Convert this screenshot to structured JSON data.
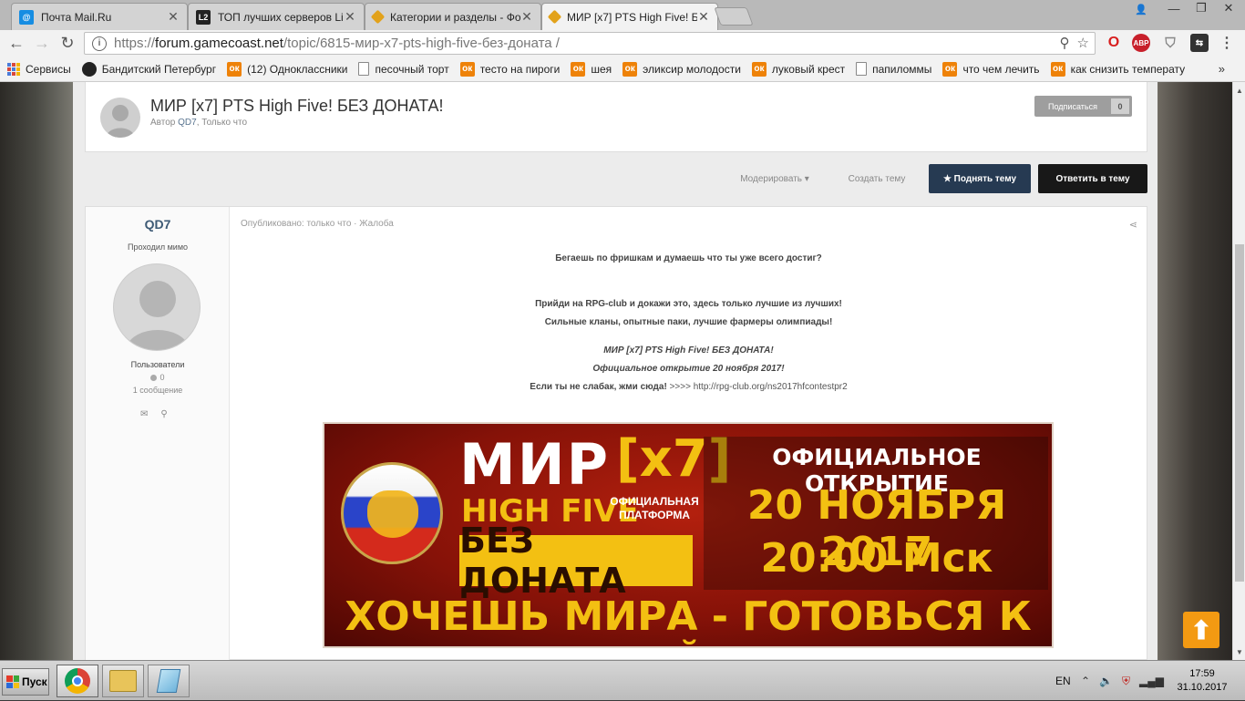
{
  "browser": {
    "tabs": [
      {
        "title": "Почта Mail.Ru",
        "icon": "mailru-icon",
        "active": false
      },
      {
        "title": "ТОП лучших серверов Lin",
        "icon": "l2-icon",
        "active": false
      },
      {
        "title": "Категории и разделы - Фо",
        "icon": "gamecoast-icon",
        "active": false
      },
      {
        "title": "МИР [x7] PTS High Five! Б",
        "icon": "gamecoast-icon",
        "active": true
      }
    ],
    "url": {
      "scheme": "https://",
      "host": "forum.gamecoast.net",
      "path": "/topic/6815-мир-x7-pts-high-five-без-доната /"
    },
    "extensions": [
      "opera-icon",
      "abp-icon",
      "shield-icon",
      "extension-icon"
    ],
    "ext_labels": {
      "abp": "ABP"
    }
  },
  "bookmarks": [
    {
      "label": "Сервисы",
      "icon": "apps-icon"
    },
    {
      "label": "Бандитский Петербург",
      "icon": "face-icon"
    },
    {
      "label": "(12) Одноклассники",
      "icon": "ok-icon"
    },
    {
      "label": "песочный торт",
      "icon": "page-icon"
    },
    {
      "label": "тесто на пироги",
      "icon": "ok-icon"
    },
    {
      "label": "шея",
      "icon": "ok-icon"
    },
    {
      "label": "эликсир молодости",
      "icon": "ok-icon"
    },
    {
      "label": "луковый крест",
      "icon": "ok-icon"
    },
    {
      "label": "папиломмы",
      "icon": "page-icon"
    },
    {
      "label": "что чем лечить",
      "icon": "ok-icon"
    },
    {
      "label": "как снизить температу",
      "icon": "ok-icon"
    }
  ],
  "bookmarks_more": "»",
  "topic": {
    "title": "МИР [x7] PTS High Five! БЕЗ ДОНАТА!",
    "author_prefix": "Автор ",
    "author": "QD7",
    "time": ", Только что",
    "subscribe_label": "Подписаться",
    "subscribe_count": "0"
  },
  "actions": {
    "moderate": "Модерировать ▾",
    "create": "Создать тему",
    "bump": "★ Поднять тему",
    "reply": "Ответить в тему"
  },
  "post": {
    "author": "QD7",
    "rank": "Проходил мимо",
    "group": "Пользователи",
    "reputation": "0",
    "posts": "1 сообщение",
    "meta_published": "Опубликовано: только что",
    "meta_sep": " · ",
    "meta_report": "Жалоба",
    "lines": {
      "l1": "Бегаешь по фришкам и думаешь что ты уже всего достиг?",
      "l2": "Прийди на RPG-club и докажи это, здесь только лучшие из лучших!",
      "l3": "Сильные кланы, опытные паки, лучшие фармеры олимпиады!",
      "l4": "МИР [x7] PTS High Five! БЕЗ ДОНАТА!",
      "l5": "Официальное открытие 20 ноября 2017!",
      "l6a": "Если ты не слабак, жми сюда! ",
      "l6b": ">>>> http://rpg-club.org/ns2017hfcontestpr2"
    }
  },
  "banner": {
    "mir": "МИР",
    "x7": "[x7]",
    "high_five": "HIGH FIVE",
    "platform_1": "ОФИЦИАЛЬНАЯ",
    "platform_2": "ПЛАТФОРМА",
    "no_donate": "БЕЗ ДОНАТА",
    "official": "ОФИЦИАЛЬНОЕ ОТКРЫТИЕ",
    "date": "20 НОЯБРЯ 2017",
    "time": "20:00 Мск",
    "slogan": "ХОЧЕШЬ МИРА - ГОТОВЬСЯ К ВОЙНЕ"
  },
  "taskbar": {
    "start": "Пуск",
    "lang": "EN",
    "time": "17:59",
    "date": "31.10.2017"
  }
}
